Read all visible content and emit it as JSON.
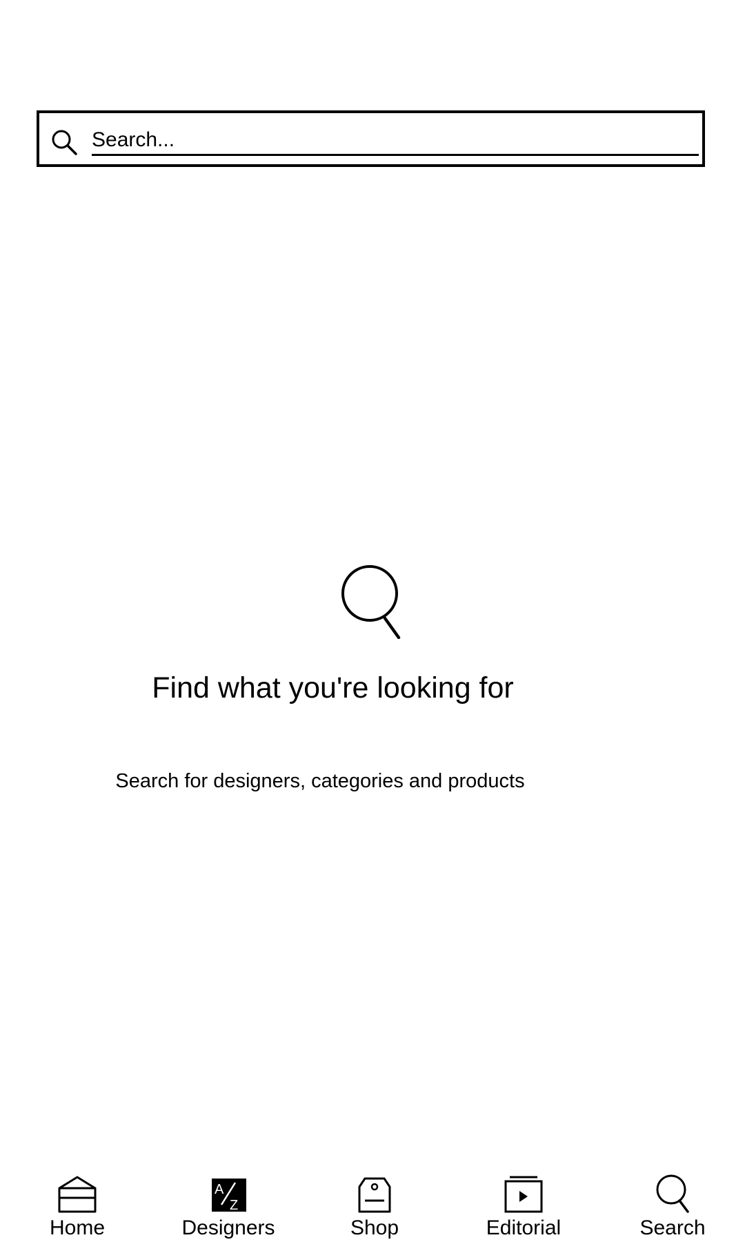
{
  "search": {
    "placeholder": "Search...",
    "value": ""
  },
  "empty_state": {
    "icon": "search-icon",
    "title": "Find what you're looking for",
    "subtitle": "Search for designers, categories and products"
  },
  "bottom_nav": {
    "items": [
      {
        "label": "Home",
        "icon": "home-icon"
      },
      {
        "label": "Designers",
        "icon": "az-icon"
      },
      {
        "label": "Shop",
        "icon": "shopping-bag-icon"
      },
      {
        "label": "Editorial",
        "icon": "editorial-play-icon"
      },
      {
        "label": "Search",
        "icon": "search-icon"
      }
    ]
  },
  "colors": {
    "foreground": "#000000",
    "background": "#ffffff"
  }
}
